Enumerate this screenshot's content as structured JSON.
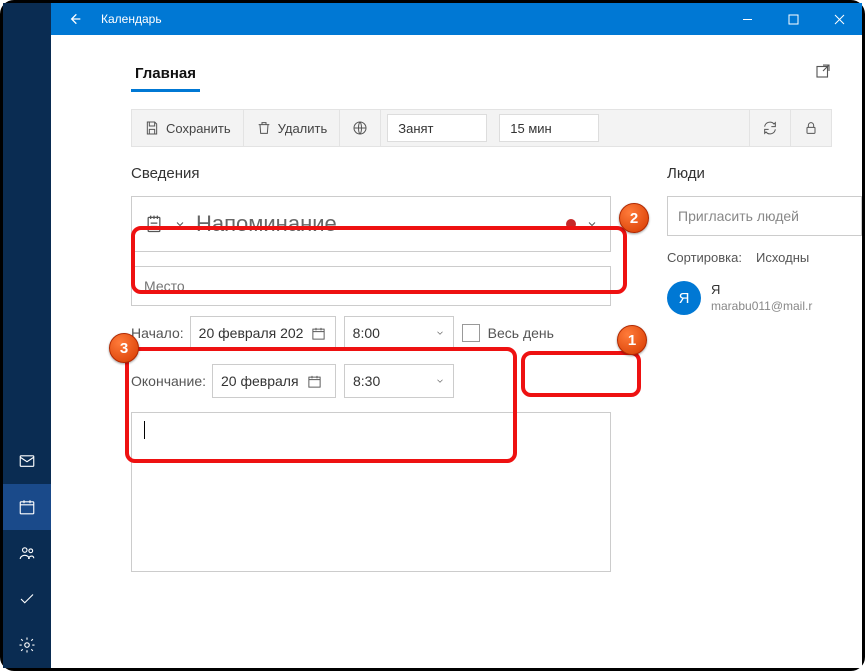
{
  "window": {
    "title": "Календарь"
  },
  "tabs": {
    "main": "Главная"
  },
  "toolbar": {
    "save": "Сохранить",
    "delete": "Удалить",
    "status": "Занят",
    "reminder": "15 мин"
  },
  "details": {
    "heading": "Сведения",
    "title_placeholder": "Напоминание",
    "location_placeholder": "Место",
    "start_label": "Начало:",
    "start_date": "20 февраля 202",
    "start_time": "8:00",
    "end_label": "Окончание:",
    "end_date": "20 февраля",
    "end_time": "8:30",
    "allday_label": "Весь день"
  },
  "people": {
    "heading": "Люди",
    "invite_placeholder": "Пригласить людей",
    "sort_label": "Сортировка:",
    "sort_value": "Исходны",
    "me_initial": "Я",
    "me_name": "Я",
    "me_email": "marabu011@mail.r"
  },
  "annotations": {
    "b1": "1",
    "b2": "2",
    "b3": "3"
  }
}
